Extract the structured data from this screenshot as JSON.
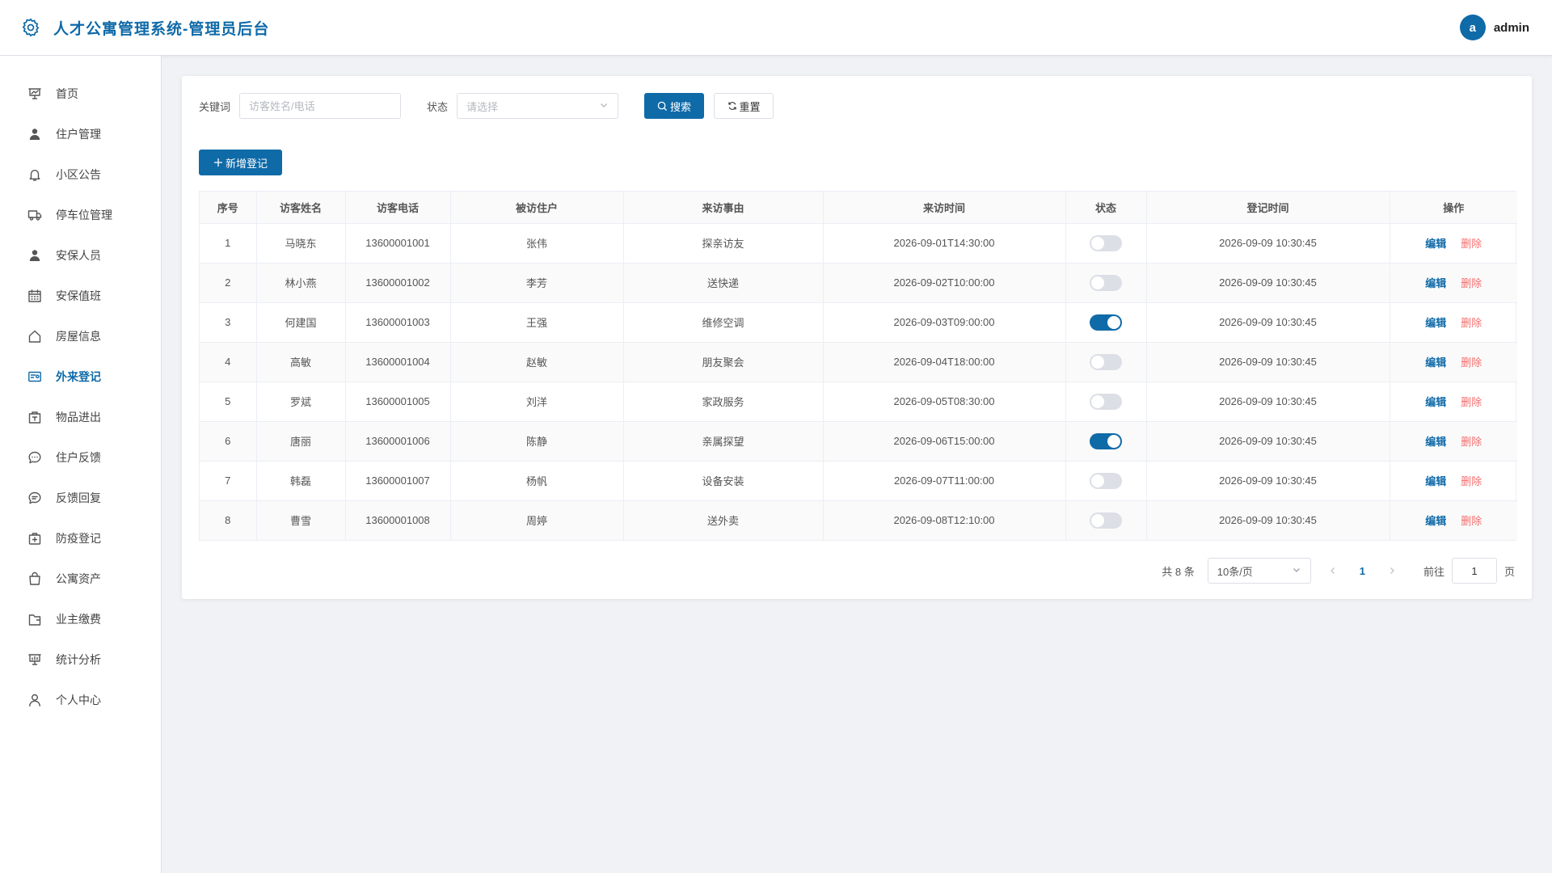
{
  "colors": {
    "accent": "#0f6aa8",
    "danger": "#f56c6c"
  },
  "header": {
    "title": "人才公寓管理系统-管理员后台",
    "avatar_letter": "a",
    "username": "admin"
  },
  "sidebar": {
    "active": "外来登记",
    "items": [
      {
        "label": "首页",
        "icon": "presentation-icon"
      },
      {
        "label": "住户管理",
        "icon": "user-icon"
      },
      {
        "label": "小区公告",
        "icon": "bell-icon"
      },
      {
        "label": "停车位管理",
        "icon": "truck-icon"
      },
      {
        "label": "安保人员",
        "icon": "user-icon"
      },
      {
        "label": "安保值班",
        "icon": "calendar-icon"
      },
      {
        "label": "房屋信息",
        "icon": "house-icon"
      },
      {
        "label": "外来登记",
        "icon": "id-card-icon"
      },
      {
        "label": "物品进出",
        "icon": "box-icon"
      },
      {
        "label": "住户反馈",
        "icon": "chat-icon"
      },
      {
        "label": "反馈回复",
        "icon": "chat-reply-icon"
      },
      {
        "label": "防疫登记",
        "icon": "medical-box-icon"
      },
      {
        "label": "公寓资产",
        "icon": "shopping-bag-icon"
      },
      {
        "label": "业主缴费",
        "icon": "wallet-icon"
      },
      {
        "label": "统计分析",
        "icon": "chart-board-icon"
      },
      {
        "label": "个人中心",
        "icon": "user-outline-icon"
      }
    ]
  },
  "filter": {
    "keyword_label": "关键词",
    "keyword_placeholder": "访客姓名/电话",
    "keyword_value": "",
    "status_label": "状态",
    "status_placeholder": "请选择",
    "search_label": "搜索",
    "reset_label": "重置"
  },
  "add_button": "新增登记",
  "table": {
    "columns": [
      "序号",
      "访客姓名",
      "访客电话",
      "被访住户",
      "来访事由",
      "来访时间",
      "状态",
      "登记时间",
      "操作"
    ],
    "edit_label": "编辑",
    "delete_label": "删除",
    "rows": [
      {
        "index": "1",
        "name": "马晓东",
        "phone": "13600001001",
        "resident": "张伟",
        "reason": "探亲访友",
        "visit_time": "2026-09-01T14:30:00",
        "status_on": false,
        "reg_time": "2026-09-09 10:30:45"
      },
      {
        "index": "2",
        "name": "林小燕",
        "phone": "13600001002",
        "resident": "李芳",
        "reason": "送快递",
        "visit_time": "2026-09-02T10:00:00",
        "status_on": false,
        "reg_time": "2026-09-09 10:30:45"
      },
      {
        "index": "3",
        "name": "何建国",
        "phone": "13600001003",
        "resident": "王强",
        "reason": "维修空调",
        "visit_time": "2026-09-03T09:00:00",
        "status_on": true,
        "reg_time": "2026-09-09 10:30:45"
      },
      {
        "index": "4",
        "name": "高敏",
        "phone": "13600001004",
        "resident": "赵敏",
        "reason": "朋友聚会",
        "visit_time": "2026-09-04T18:00:00",
        "status_on": false,
        "reg_time": "2026-09-09 10:30:45"
      },
      {
        "index": "5",
        "name": "罗斌",
        "phone": "13600001005",
        "resident": "刘洋",
        "reason": "家政服务",
        "visit_time": "2026-09-05T08:30:00",
        "status_on": false,
        "reg_time": "2026-09-09 10:30:45"
      },
      {
        "index": "6",
        "name": "唐丽",
        "phone": "13600001006",
        "resident": "陈静",
        "reason": "亲属探望",
        "visit_time": "2026-09-06T15:00:00",
        "status_on": true,
        "reg_time": "2026-09-09 10:30:45"
      },
      {
        "index": "7",
        "name": "韩磊",
        "phone": "13600001007",
        "resident": "杨帆",
        "reason": "设备安装",
        "visit_time": "2026-09-07T11:00:00",
        "status_on": false,
        "reg_time": "2026-09-09 10:30:45"
      },
      {
        "index": "8",
        "name": "曹雪",
        "phone": "13600001008",
        "resident": "周婷",
        "reason": "送外卖",
        "visit_time": "2026-09-08T12:10:00",
        "status_on": false,
        "reg_time": "2026-09-09 10:30:45"
      }
    ]
  },
  "pagination": {
    "total_text": "共 8 条",
    "page_size": "10条/页",
    "current_page": "1",
    "goto_label": "前往",
    "goto_value": "1",
    "page_suffix": "页"
  }
}
